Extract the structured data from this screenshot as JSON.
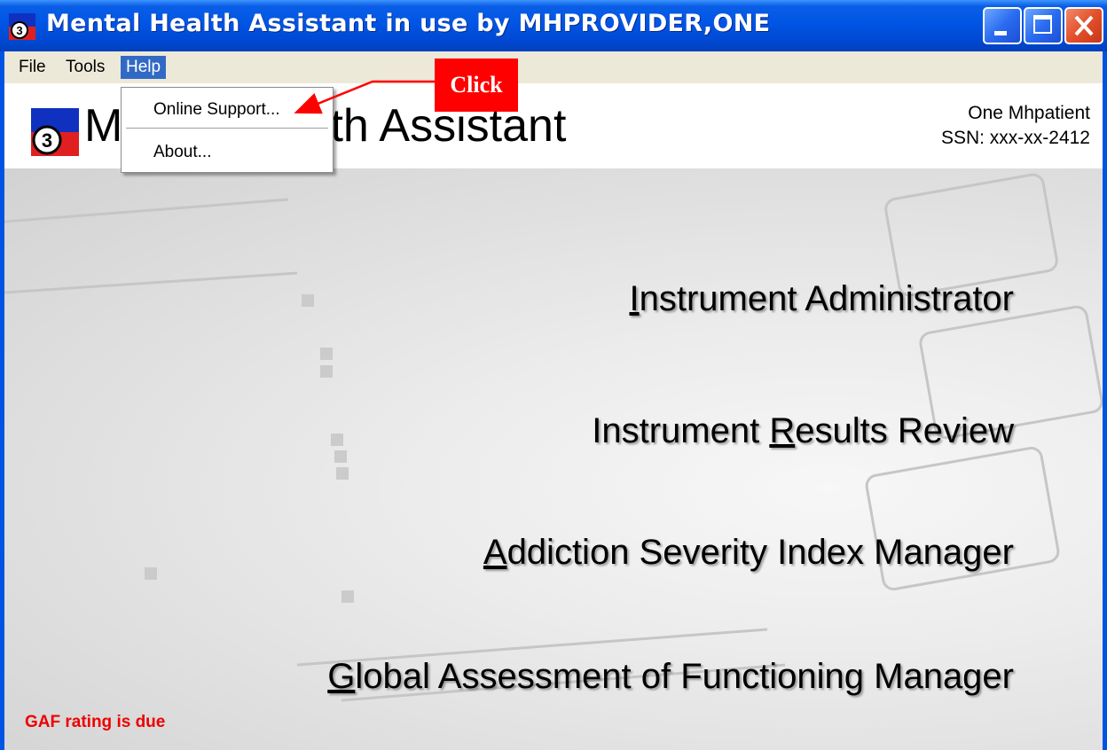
{
  "window": {
    "title": "Mental Health Assistant in use by MHPROVIDER,ONE"
  },
  "menubar": {
    "items": [
      {
        "label": "File"
      },
      {
        "label": "Tools"
      },
      {
        "label": "Help"
      }
    ]
  },
  "help_menu": {
    "items": [
      {
        "label": "Online Support..."
      },
      {
        "label": "About..."
      }
    ]
  },
  "header": {
    "title": "Mental Health Assistant",
    "patient_name": "One Mhpatient",
    "patient_ssn": "SSN: xxx-xx-2412"
  },
  "nav": {
    "instrument_admin": {
      "pre": "",
      "key": "I",
      "post": "nstrument Administrator"
    },
    "results_review": {
      "pre": "Instrument ",
      "key": "R",
      "post": "esults Review"
    },
    "asi_manager": {
      "pre": "",
      "key": "A",
      "post": "ddiction Severity Index Manager"
    },
    "gaf_manager": {
      "pre": "",
      "key": "G",
      "post": "lobal Assessment of Functioning Manager"
    }
  },
  "status": {
    "message": "GAF rating is due",
    "color": "#ee0000"
  },
  "annotation": {
    "label": "Click",
    "color": "#ff0000"
  },
  "icons": [
    "app-logo-icon",
    "minimize-icon",
    "maximize-icon",
    "close-icon"
  ]
}
